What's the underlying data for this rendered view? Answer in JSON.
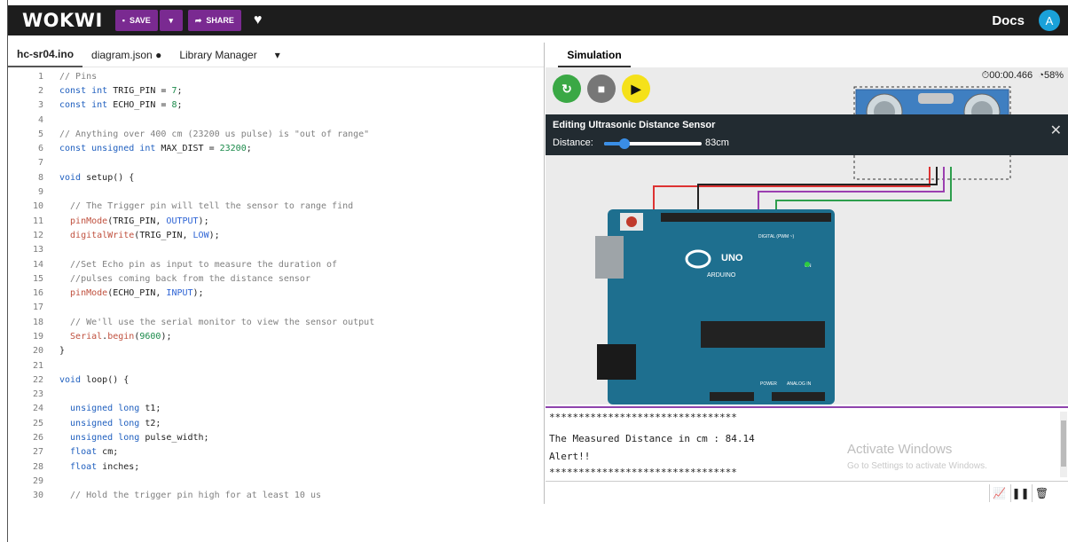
{
  "app": {
    "logo": "WOKWI",
    "save_label": "SAVE",
    "share_label": "SHARE",
    "docs_label": "Docs",
    "avatar_letter": "A"
  },
  "editor": {
    "tabs": [
      "hc-sr04.ino",
      "diagram.json ●",
      "Library Manager",
      "▾"
    ],
    "lines": [
      {
        "n": "1",
        "segs": [
          {
            "t": "// Pins",
            "c": "com"
          }
        ]
      },
      {
        "n": "2",
        "segs": [
          {
            "t": "const int ",
            "c": "kw"
          },
          {
            "t": "TRIG_PIN = ",
            "c": "txt"
          },
          {
            "t": "7",
            "c": "num"
          },
          {
            "t": ";",
            "c": "txt"
          }
        ]
      },
      {
        "n": "3",
        "segs": [
          {
            "t": "const int ",
            "c": "kw"
          },
          {
            "t": "ECHO_PIN = ",
            "c": "txt"
          },
          {
            "t": "8",
            "c": "num"
          },
          {
            "t": ";",
            "c": "txt"
          }
        ]
      },
      {
        "n": "4",
        "segs": []
      },
      {
        "n": "5",
        "segs": [
          {
            "t": "// Anything over 400 cm (23200 us pulse) is \"out of range\"",
            "c": "com"
          }
        ]
      },
      {
        "n": "6",
        "segs": [
          {
            "t": "const unsigned int ",
            "c": "kw"
          },
          {
            "t": "MAX_DIST = ",
            "c": "txt"
          },
          {
            "t": "23200",
            "c": "num"
          },
          {
            "t": ";",
            "c": "txt"
          }
        ]
      },
      {
        "n": "7",
        "segs": []
      },
      {
        "n": "8",
        "segs": [
          {
            "t": "void ",
            "c": "kw"
          },
          {
            "t": "setup() {",
            "c": "txt"
          }
        ]
      },
      {
        "n": "9",
        "segs": []
      },
      {
        "n": "10",
        "segs": [
          {
            "t": "  // The Trigger pin will tell the sensor to range find",
            "c": "com"
          }
        ]
      },
      {
        "n": "11",
        "segs": [
          {
            "t": "  pinMode",
            "c": "fn"
          },
          {
            "t": "(TRIG_PIN, ",
            "c": "txt"
          },
          {
            "t": "OUTPUT",
            "c": "const"
          },
          {
            "t": ");",
            "c": "txt"
          }
        ]
      },
      {
        "n": "12",
        "segs": [
          {
            "t": "  digitalWrite",
            "c": "fn"
          },
          {
            "t": "(TRIG_PIN, ",
            "c": "txt"
          },
          {
            "t": "LOW",
            "c": "const"
          },
          {
            "t": ");",
            "c": "txt"
          }
        ]
      },
      {
        "n": "13",
        "segs": []
      },
      {
        "n": "14",
        "segs": [
          {
            "t": "  //Set Echo pin as input to measure the duration of",
            "c": "com"
          }
        ]
      },
      {
        "n": "15",
        "segs": [
          {
            "t": "  //pulses coming back from the distance sensor",
            "c": "com"
          }
        ]
      },
      {
        "n": "16",
        "segs": [
          {
            "t": "  pinMode",
            "c": "fn"
          },
          {
            "t": "(ECHO_PIN, ",
            "c": "txt"
          },
          {
            "t": "INPUT",
            "c": "const"
          },
          {
            "t": ");",
            "c": "txt"
          }
        ]
      },
      {
        "n": "17",
        "segs": []
      },
      {
        "n": "18",
        "segs": [
          {
            "t": "  // We'll use the serial monitor to view the sensor output",
            "c": "com"
          }
        ]
      },
      {
        "n": "19",
        "segs": [
          {
            "t": "  Serial",
            "c": "fn"
          },
          {
            "t": ".",
            "c": "txt"
          },
          {
            "t": "begin",
            "c": "fn"
          },
          {
            "t": "(",
            "c": "txt"
          },
          {
            "t": "9600",
            "c": "num"
          },
          {
            "t": ");",
            "c": "txt"
          }
        ]
      },
      {
        "n": "20",
        "segs": [
          {
            "t": "}",
            "c": "txt"
          }
        ]
      },
      {
        "n": "21",
        "segs": []
      },
      {
        "n": "22",
        "segs": [
          {
            "t": "void ",
            "c": "kw"
          },
          {
            "t": "loop() {",
            "c": "txt"
          }
        ]
      },
      {
        "n": "23",
        "segs": []
      },
      {
        "n": "24",
        "segs": [
          {
            "t": "  unsigned long ",
            "c": "kw"
          },
          {
            "t": "t1;",
            "c": "txt"
          }
        ]
      },
      {
        "n": "25",
        "segs": [
          {
            "t": "  unsigned long ",
            "c": "kw"
          },
          {
            "t": "t2;",
            "c": "txt"
          }
        ]
      },
      {
        "n": "26",
        "segs": [
          {
            "t": "  unsigned long ",
            "c": "kw"
          },
          {
            "t": "pulse_width;",
            "c": "txt"
          }
        ]
      },
      {
        "n": "27",
        "segs": [
          {
            "t": "  float ",
            "c": "kw"
          },
          {
            "t": "cm;",
            "c": "txt"
          }
        ]
      },
      {
        "n": "28",
        "segs": [
          {
            "t": "  float ",
            "c": "kw"
          },
          {
            "t": "inches;",
            "c": "txt"
          }
        ]
      },
      {
        "n": "29",
        "segs": []
      },
      {
        "n": "30",
        "segs": [
          {
            "t": "  // Hold the trigger pin high for at least 10 us",
            "c": "com"
          }
        ]
      }
    ]
  },
  "simulation": {
    "tab_label": "Simulation",
    "timer": "⏱00:00.466",
    "speed": "58%",
    "edit_title": "Editing Ultrasonic Distance Sensor",
    "distance_label": "Distance:",
    "distance_value": "83cm",
    "distance_fraction": 0.21,
    "board_labels": {
      "uno": "UNO",
      "arduino": "ARDUINO",
      "digital": "DIGITAL (PWM ~)",
      "on": "ON",
      "analog": "ANALOG IN",
      "power": "POWER"
    }
  },
  "monitor": {
    "lines": [
      "********************************",
      "",
      "The Measured Distance in cm : 84.14",
      "Alert!!",
      "********************************"
    ],
    "watermark_title": "Activate Windows",
    "watermark_sub": "Go to Settings to activate Windows."
  },
  "colors": {
    "accent": "#7a2a91",
    "run": "#3aa845",
    "play": "#f5e11a",
    "board": "#1e6f8f"
  }
}
